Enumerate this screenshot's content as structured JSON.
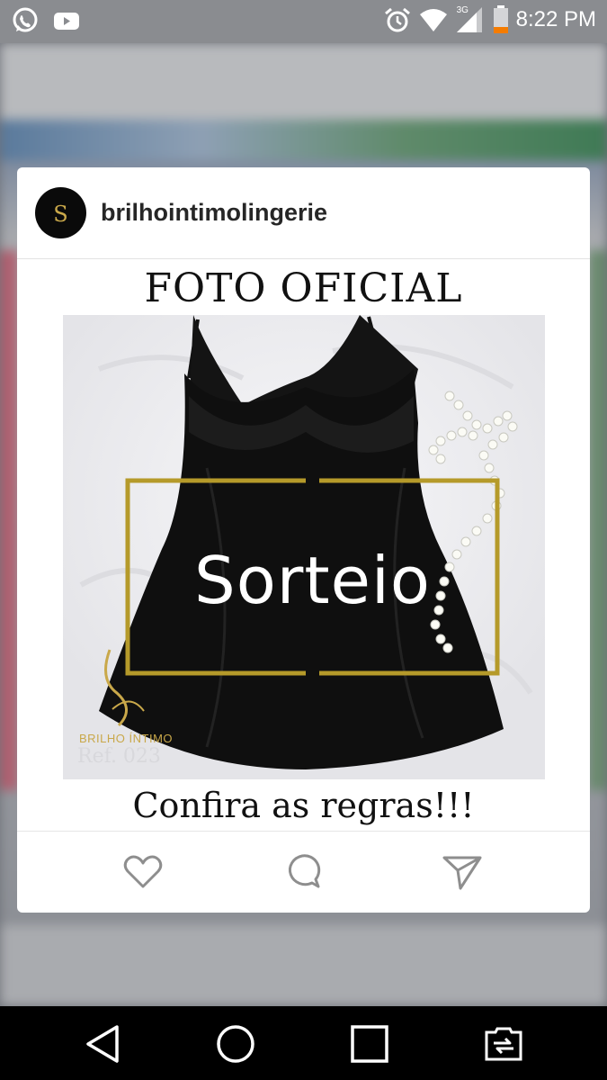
{
  "status_bar": {
    "time": "8:22 PM",
    "network": "3G",
    "left_icons": [
      "whatsapp-icon",
      "youtube-icon"
    ],
    "right_icons": [
      "alarm-icon",
      "wifi-icon",
      "cell-signal-icon",
      "battery-icon"
    ]
  },
  "post": {
    "username": "brilhointimolingerie",
    "avatar_icon": "brand-logo-icon",
    "title": "FOTO OFICIAL",
    "overlay_text": "Sorteio",
    "brand_text": "BRILHO ÍNTIMO",
    "ref_text": "Ref. 023",
    "footer_text": "Confira as regras!!!"
  },
  "actions": [
    "heart-icon",
    "comment-icon",
    "share-icon"
  ],
  "nav": [
    "back-icon",
    "home-icon",
    "recents-icon",
    "switch-sim-icon"
  ],
  "colors": {
    "accent_gold": "#b59a2a",
    "status_bar": "#8a8c90",
    "nav_bar": "#000000"
  }
}
